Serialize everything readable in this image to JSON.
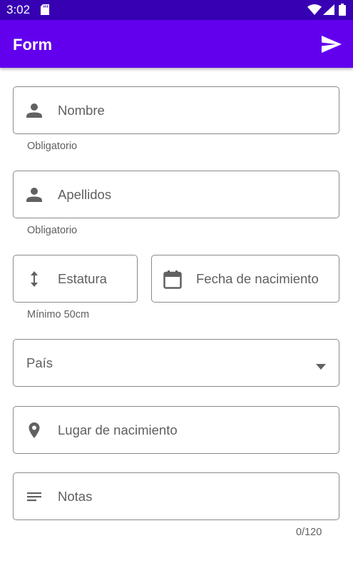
{
  "status_bar": {
    "time": "3:02",
    "icons": [
      "sd-card-icon",
      "wifi-icon",
      "signal-icon",
      "battery-icon"
    ]
  },
  "app_bar": {
    "title": "Form",
    "action_icon": "send-icon"
  },
  "colors": {
    "status_bar": "#3700b3",
    "app_bar": "#6200ee",
    "field_border": "#8a8a8a",
    "icon": "#616161",
    "label_text": "#5f5f5f"
  },
  "form": {
    "nombre": {
      "label": "Nombre",
      "helper": "Obligatorio",
      "icon": "person-icon"
    },
    "apellidos": {
      "label": "Apellidos",
      "helper": "Obligatorio",
      "icon": "person-icon"
    },
    "estatura": {
      "label": "Estatura",
      "helper": "Mínimo 50cm",
      "icon": "height-arrows-icon"
    },
    "fecha": {
      "label": "Fecha de nacimiento",
      "icon": "calendar-icon"
    },
    "pais": {
      "label": "País",
      "icon": "dropdown-arrow-icon"
    },
    "lugar": {
      "label": "Lugar de nacimiento",
      "icon": "location-pin-icon"
    },
    "notas": {
      "label": "Notas",
      "counter": "0/120",
      "icon": "notes-icon"
    }
  }
}
